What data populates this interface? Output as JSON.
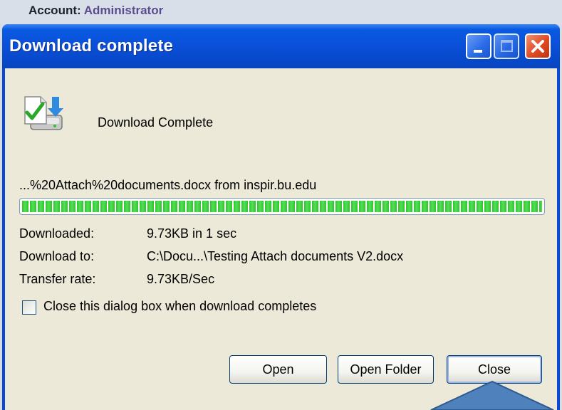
{
  "background_page": {
    "account_label": "Account:",
    "account_value": "Administrator"
  },
  "window": {
    "title": "Download complete",
    "title_buttons": [
      "minimize-icon",
      "maximize-icon",
      "close-icon"
    ]
  },
  "status": {
    "icon": "download-complete-icon",
    "heading": "Download Complete",
    "source_line": "...%20Attach%20documents.docx from inspir.bu.edu",
    "progress": 1.0
  },
  "info": {
    "downloaded_label": "Downloaded:",
    "downloaded_value": "9.73KB in 1 sec",
    "download_to_label": "Download to:",
    "download_to_value": "C:\\Docu...\\Testing Attach documents V2.docx",
    "transfer_rate_label": "Transfer rate:",
    "transfer_rate_value": "9.73KB/Sec"
  },
  "options": {
    "close_when_done_label": "Close this dialog box when download completes",
    "close_when_done_checked": false
  },
  "buttons": {
    "open": "Open",
    "open_folder": "Open Folder",
    "close": "Close"
  },
  "colors": {
    "titlebar": "#0a4fd8",
    "client": "#ece9d8",
    "progress": "#2ec42e",
    "close_button": "#e04a23",
    "callout_arrow": "#4f81bd"
  }
}
